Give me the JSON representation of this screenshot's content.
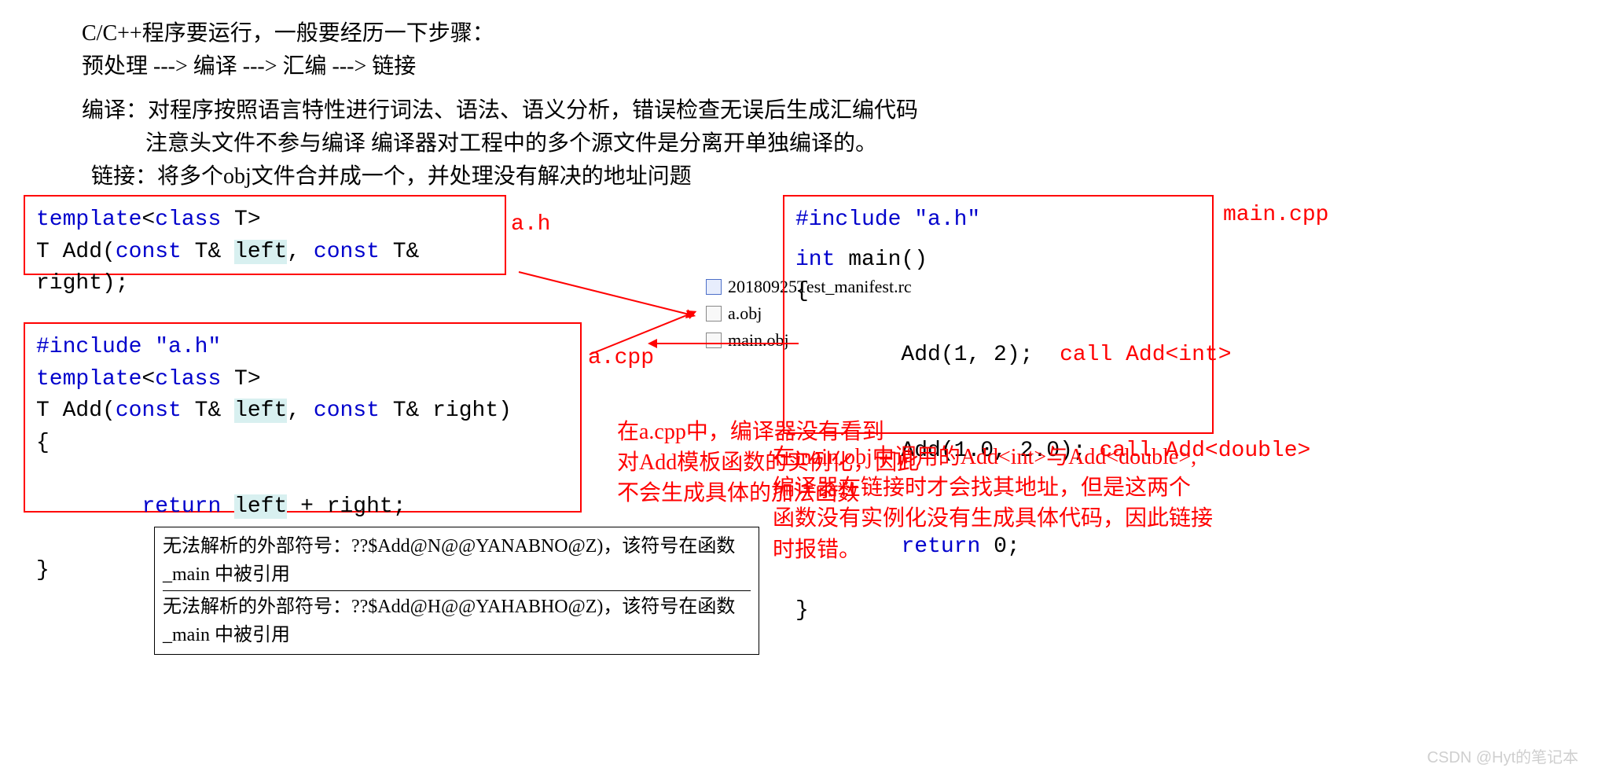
{
  "header": {
    "line1": "C/C++程序要运行，一般要经历一下步骤：",
    "line2": "预处理 ---> 编译 ---> 汇编 ---> 链接",
    "line3": "编译：对程序按照语言特性进行词法、语法、语义分析，错误检查无误后生成汇编代码",
    "line4": "注意头文件不参与编译  编译器对工程中的多个源文件是分离开单独编译的。",
    "line5": "链接：将多个obj文件合并成一个，并处理没有解决的地址问题"
  },
  "boxes": {
    "ah": {
      "label": "a.h",
      "l1_kw1": "template",
      "l1_op1": "<",
      "l1_kw2": "class",
      "l1_t": " T",
      "l1_op2": ">",
      "l2_t1": "T ",
      "l2_fn": "Add",
      "l2_p1": "(",
      "l2_kw1": "const",
      "l2_t2": " T& ",
      "l2_hl1": "left",
      "l2_c": ", ",
      "l2_kw2": "const",
      "l2_t3": " T& right);"
    },
    "acpp": {
      "label": "a.cpp",
      "l1": "#include \"a.h\"",
      "l2_a": "template",
      "l2_b": "<",
      "l2_c": "class",
      "l2_d": " T",
      "l2_e": ">",
      "l3_a": "T Add(",
      "l3_b": "const",
      "l3_c": " T& ",
      "l3_hl": "left",
      "l3_d": ", ",
      "l3_e": "const",
      "l3_f": " T& right)",
      "l4": "{",
      "l5_a": "    ",
      "l5_b": "return",
      "l5_c": " ",
      "l5_hl": "left",
      "l5_d": " + right;",
      "l6": "}"
    },
    "main": {
      "label": "main.cpp",
      "l1": "#include \"a.h\"",
      "l2_a": "int",
      "l2_b": " main()",
      "l3": "{",
      "l4": "    Add(1, 2);",
      "l4_note": "call Add<int>",
      "l5": "    Add(1.0, 2.0);",
      "l5_note": "call Add<double>",
      "l6_a": "    ",
      "l6_b": "return",
      "l6_c": " 0;",
      "l7": "}"
    }
  },
  "files": {
    "f1": "20180925Test_manifest.rc",
    "f2": "a.obj",
    "f3": "main.obj"
  },
  "notes": {
    "acpp_note_l1": "在a.cpp中，编译器没有看到",
    "acpp_note_l2": "对Add模板函数的实例化，因此",
    "acpp_note_l3": "不会生成具体的加法函数",
    "main_note_l1": "在main.obj中调用的Add<int>与Add<double>,",
    "main_note_l2": "编译器在链接时才会找其地址，但是这两个",
    "main_note_l3": "函数没有实例化没有生成具体代码，因此链接",
    "main_note_l4": "时报错。"
  },
  "errors": {
    "e1": "无法解析的外部符号：??$Add@N@@YANABNO@Z)，该符号在函数 _main 中被引用",
    "e2": "无法解析的外部符号：??$Add@H@@YAHABHO@Z)，该符号在函数 _main 中被引用"
  },
  "watermark": "CSDN @Hyt的笔记本"
}
